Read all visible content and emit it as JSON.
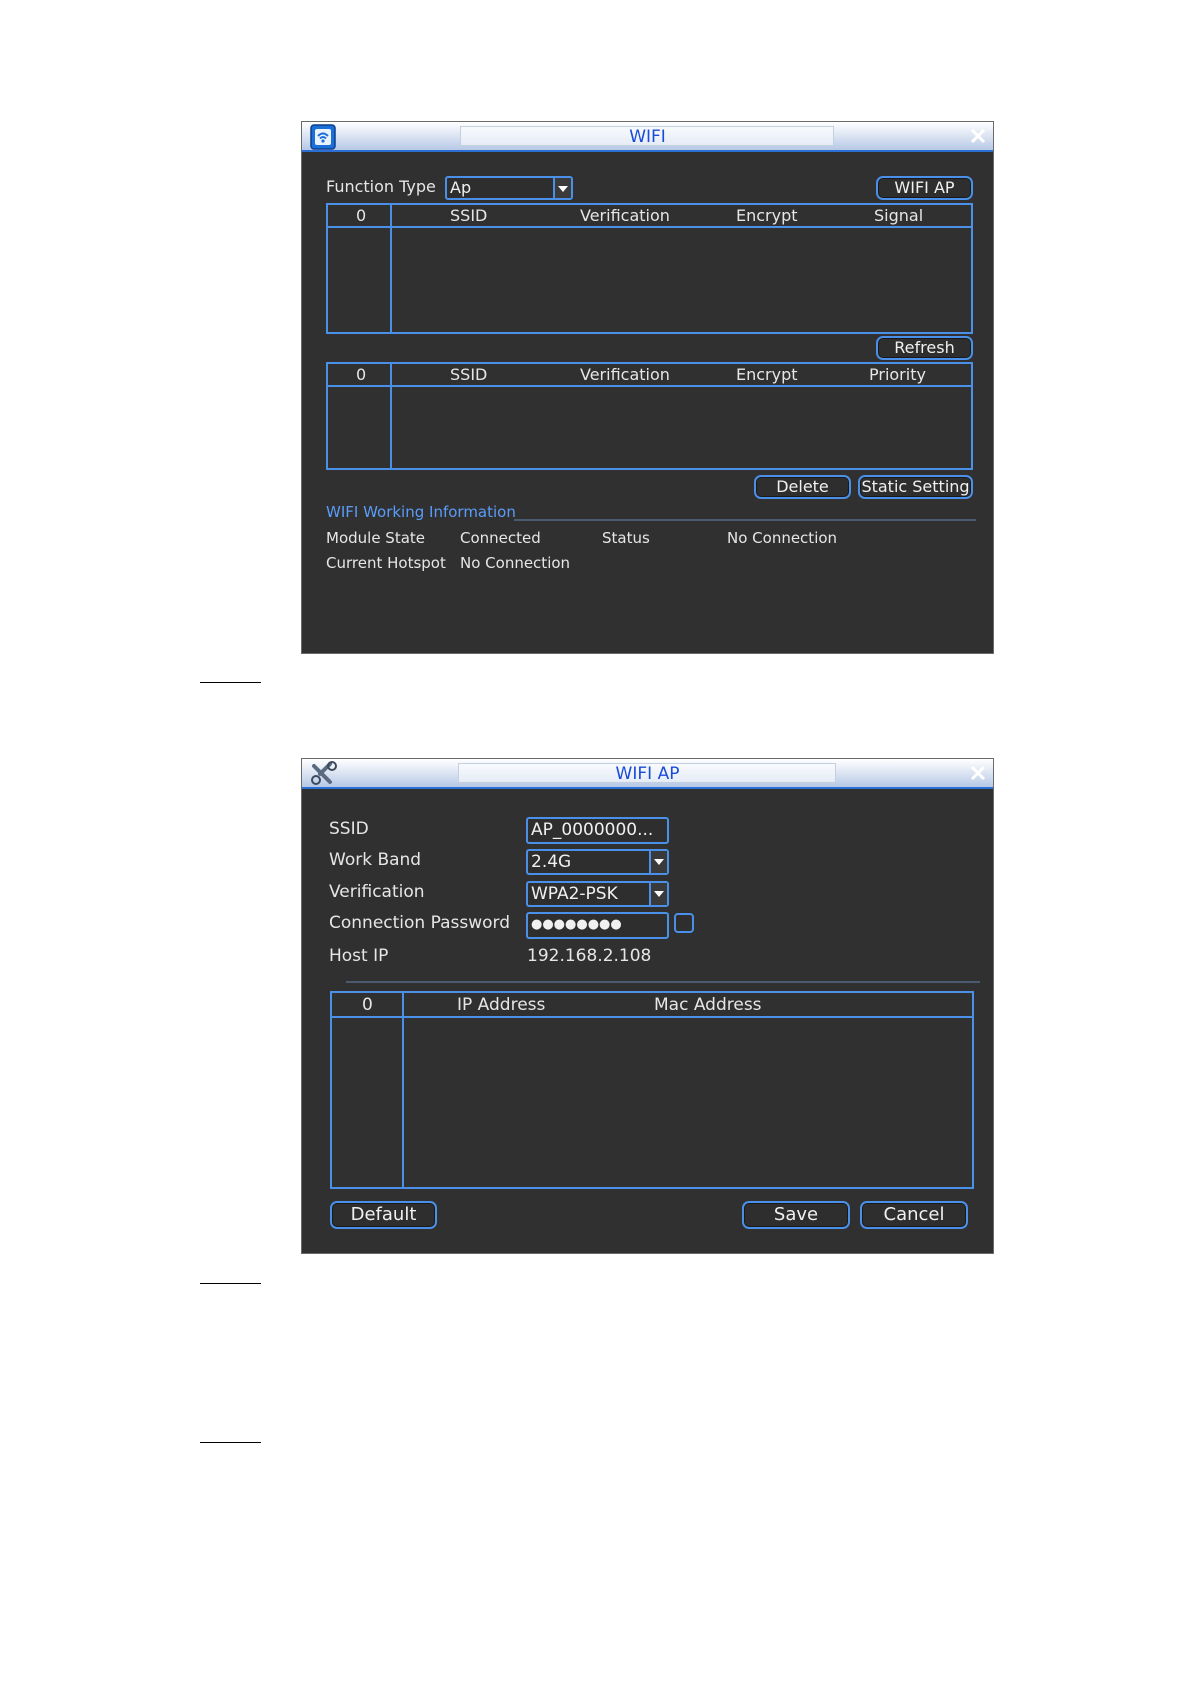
{
  "wifi_window": {
    "title": "WIFI",
    "function_type_label": "Function Type",
    "function_type_value": "Ap",
    "wifi_ap_button": "WIFI AP",
    "scan_table": {
      "headers": [
        "0",
        "SSID",
        "Verification",
        "Encrypt",
        "Signal"
      ]
    },
    "refresh_button": "Refresh",
    "saved_table": {
      "headers": [
        "0",
        "SSID",
        "Verification",
        "Encrypt",
        "Priority"
      ]
    },
    "delete_button": "Delete",
    "static_setting_button": "Static Setting",
    "working_info_title": "WIFI Working Information",
    "module_state_label": "Module State",
    "module_state_value": "Connected",
    "status_label": "Status",
    "status_value": "No Connection",
    "current_hotspot_label": "Current Hotspot",
    "current_hotspot_value": "No Connection"
  },
  "wifi_ap_window": {
    "title": "WIFI AP",
    "ssid_label": "SSID",
    "ssid_value": "AP_0000000...",
    "work_band_label": "Work Band",
    "work_band_value": "2.4G",
    "verification_label": "Verification",
    "verification_value": "WPA2-PSK",
    "password_label": "Connection Password",
    "password_value": "●●●●●●●●",
    "host_ip_label": "Host IP",
    "host_ip_value": "192.168.2.108",
    "client_table": {
      "headers": [
        "0",
        "IP Address",
        "Mac Address"
      ]
    },
    "default_button": "Default",
    "save_button": "Save",
    "cancel_button": "Cancel"
  },
  "colors": {
    "window_bg": "#303030",
    "accent_blue": "#4a8fe8",
    "title_text": "#1a4ad8",
    "info_title": "#5a9cf8"
  }
}
